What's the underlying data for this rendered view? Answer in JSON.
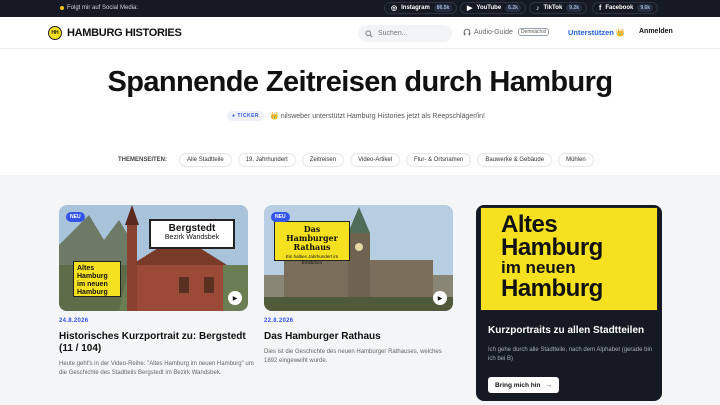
{
  "topbar": {
    "follow_label": "Folgt mir auf Social Media:",
    "socials": [
      {
        "name": "Instagram",
        "count": "86.5k",
        "icon": "instagram-icon"
      },
      {
        "name": "YouTube",
        "count": "6.2k",
        "icon": "youtube-icon"
      },
      {
        "name": "TikTok",
        "count": "9.2k",
        "icon": "tiktok-icon"
      },
      {
        "name": "Facebook",
        "count": "9.6k",
        "icon": "facebook-icon"
      }
    ]
  },
  "header": {
    "logo_text": "HAMBURG HISTORIES",
    "logo_badge": "HH",
    "search_placeholder": "Suchen...",
    "audio_label": "Audio-Guide",
    "audio_tag": "Demnächst",
    "support_label": "Unterstützen 👑",
    "login_label": "Anmelden"
  },
  "hero": {
    "title": "Spannende Zeitreisen durch Hamburg",
    "ticker_label": "TICKER",
    "ticker_text": "👑 nilsweber unterstützt Hamburg Histories jetzt als Reepschläger/in!"
  },
  "topics": {
    "label": "THEMENSEITEN:",
    "chips": [
      "Alle Stadtteile",
      "19. Jahrhundert",
      "Zeitreisen",
      "Video-Artikel",
      "Flur- & Ortsnamen",
      "Bauwerke & Gebäude",
      "Mühlen"
    ]
  },
  "cards": [
    {
      "badge": "NEU",
      "sign_title": "Bergstedt",
      "sign_sub": "Bezirk Wandsbek",
      "overlay": "Altes Hamburg im neuen Hamburg",
      "date": "24.8.2026",
      "title": "Historisches Kurzportrait zu: Bergstedt (11 / 104)",
      "desc": "Heute geht's in der Video-Reihe: \"Altes Hamburg im neuen Hamburg\" um die Geschichte des Stadtteils Bergstedt im Bezirk Wandsbek."
    },
    {
      "badge": "NEU",
      "sign_title": "Das Hamburger Rathaus",
      "sign_sub": "Ein halbes Jahrhundert im Entstehen",
      "date": "22.8.2026",
      "title": "Das Hamburger Rathaus",
      "desc": "Dies ist die Geschichte des neuen Hamburger Rathauses, welches 1892 eingeweiht wurde."
    }
  ],
  "promo": {
    "line1": "Altes",
    "line2": "Hamburg",
    "line3": "im neuen",
    "line4": "Hamburg",
    "title": "Kurzportraits zu allen Stadtteilen",
    "desc": "Ich gehe durch alle Stadtteile, nach dem Alphabet (gerade bin ich bei B)",
    "button": "Bring mich hin"
  },
  "colors": {
    "accent_blue": "#3355e8",
    "brand_yellow": "#f5e11f",
    "dark": "#141923"
  }
}
